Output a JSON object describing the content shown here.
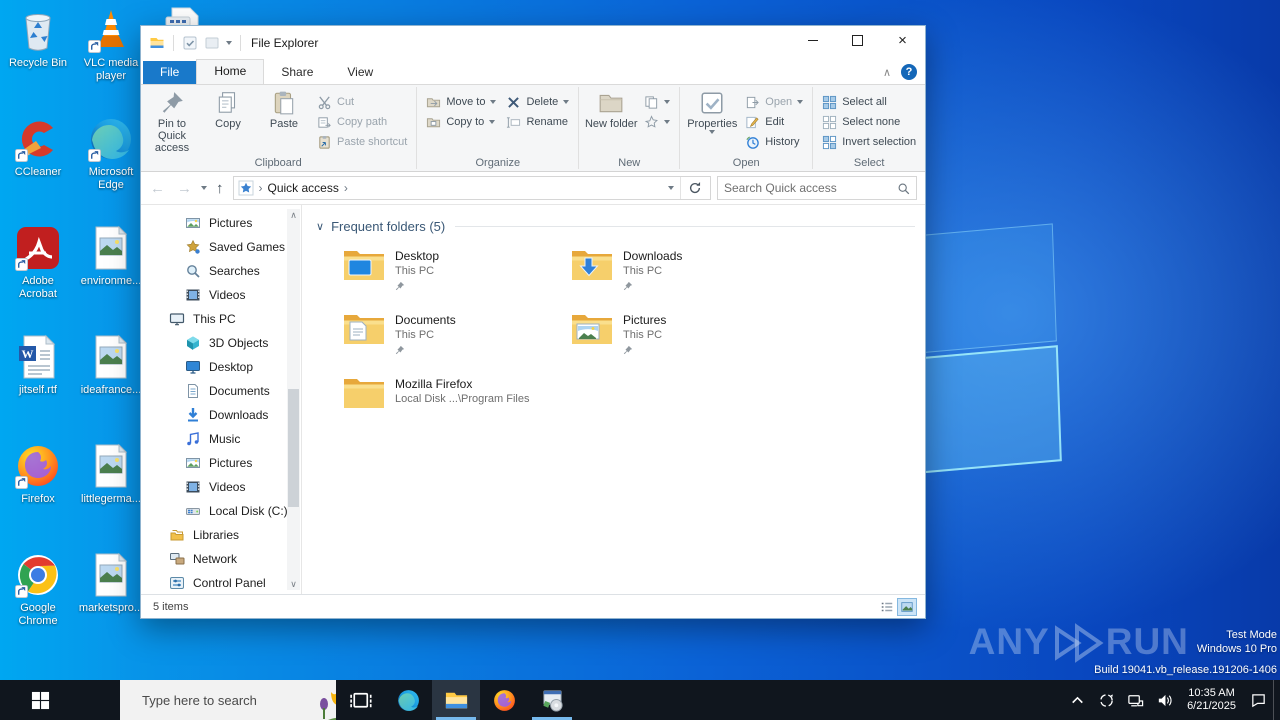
{
  "colors": {
    "accent": "#1979ca",
    "taskbar": "#10161e",
    "desktop_left": "#00a7f1",
    "desktop_right": "#0840b4",
    "folder_yellow": "#f6cf6b"
  },
  "desktop": {
    "icons": [
      {
        "label": "Recycle Bin",
        "icon": "recycle-bin",
        "shortcut": false
      },
      {
        "label": "CCleaner",
        "icon": "ccleaner",
        "shortcut": true
      },
      {
        "label": "Adobe Acrobat",
        "icon": "acrobat",
        "shortcut": true
      },
      {
        "label": "jitself.rtf",
        "icon": "rtf-doc",
        "shortcut": false
      },
      {
        "label": "Firefox",
        "icon": "firefox",
        "shortcut": true
      },
      {
        "label": "Google Chrome",
        "icon": "chrome",
        "shortcut": true
      },
      {
        "label": "VLC media player",
        "icon": "vlc",
        "shortcut": true
      },
      {
        "label": "Microsoft Edge",
        "icon": "edge",
        "shortcut": true
      },
      {
        "label": "environme...",
        "icon": "image-file",
        "shortcut": false
      },
      {
        "label": "ideafrance...",
        "icon": "image-file",
        "shortcut": false
      },
      {
        "label": "littlegerma...",
        "icon": "image-file",
        "shortcut": false
      },
      {
        "label": "marketspro...",
        "icon": "image-file",
        "shortcut": false
      }
    ]
  },
  "window": {
    "title": "File Explorer",
    "tabs": [
      "File",
      "Home",
      "Share",
      "View"
    ],
    "ribbon": {
      "pin": "Pin to Quick access",
      "copy": "Copy",
      "paste": "Paste",
      "cut": "Cut",
      "copy_path": "Copy path",
      "paste_shortcut": "Paste shortcut",
      "clipboard": "Clipboard",
      "move_to": "Move to",
      "copy_to": "Copy to",
      "delete": "Delete",
      "rename": "Rename",
      "organize": "Organize",
      "new_folder": "New folder",
      "new_group": "New",
      "properties": "Properties",
      "open": "Open",
      "edit": "Edit",
      "history": "History",
      "open_group": "Open",
      "select_all": "Select all",
      "select_none": "Select none",
      "invert": "Invert selection",
      "select_group": "Select"
    },
    "address": {
      "breadcrumb": "Quick access",
      "search_placeholder": "Search Quick access"
    },
    "sidebar": [
      {
        "label": "Pictures",
        "icon": "pictures",
        "level": 2
      },
      {
        "label": "Saved Games",
        "icon": "saved-games",
        "level": 2
      },
      {
        "label": "Searches",
        "icon": "searches",
        "level": 2
      },
      {
        "label": "Videos",
        "icon": "videos",
        "level": 2
      },
      {
        "label": "This PC",
        "icon": "this-pc",
        "level": 1
      },
      {
        "label": "3D Objects",
        "icon": "3d-objects",
        "level": 2
      },
      {
        "label": "Desktop",
        "icon": "desktop",
        "level": 2
      },
      {
        "label": "Documents",
        "icon": "documents",
        "level": 2
      },
      {
        "label": "Downloads",
        "icon": "downloads",
        "level": 2
      },
      {
        "label": "Music",
        "icon": "music",
        "level": 2
      },
      {
        "label": "Pictures",
        "icon": "pictures",
        "level": 2
      },
      {
        "label": "Videos",
        "icon": "videos",
        "level": 2
      },
      {
        "label": "Local Disk (C:)",
        "icon": "local-disk",
        "level": 2
      },
      {
        "label": "Libraries",
        "icon": "libraries",
        "level": 1
      },
      {
        "label": "Network",
        "icon": "network",
        "level": 1
      },
      {
        "label": "Control Panel",
        "icon": "control-panel",
        "level": 1
      }
    ],
    "content": {
      "section_title": "Frequent folders (5)",
      "tiles": [
        {
          "name": "Desktop",
          "sub": "This PC",
          "icon": "folder-desktop",
          "pinned": true
        },
        {
          "name": "Downloads",
          "sub": "This PC",
          "icon": "folder-downloads",
          "pinned": true
        },
        {
          "name": "Documents",
          "sub": "This PC",
          "icon": "folder-documents",
          "pinned": true
        },
        {
          "name": "Pictures",
          "sub": "This PC",
          "icon": "folder-pictures",
          "pinned": true
        },
        {
          "name": "Mozilla Firefox",
          "sub": "Local Disk ...\\Program Files",
          "icon": "folder-plain",
          "pinned": false
        }
      ]
    },
    "status": {
      "items_count": "5 items"
    }
  },
  "taskbar": {
    "search_placeholder": "Type here to search",
    "time": "10:35 AM",
    "date": "6/21/2025"
  },
  "watermark": {
    "brand_left": "ANY",
    "brand_right": "RUN",
    "mode": "Test Mode",
    "os": "Windows 10 Pro",
    "build": "Build 19041.vb_release.191206-1406"
  }
}
